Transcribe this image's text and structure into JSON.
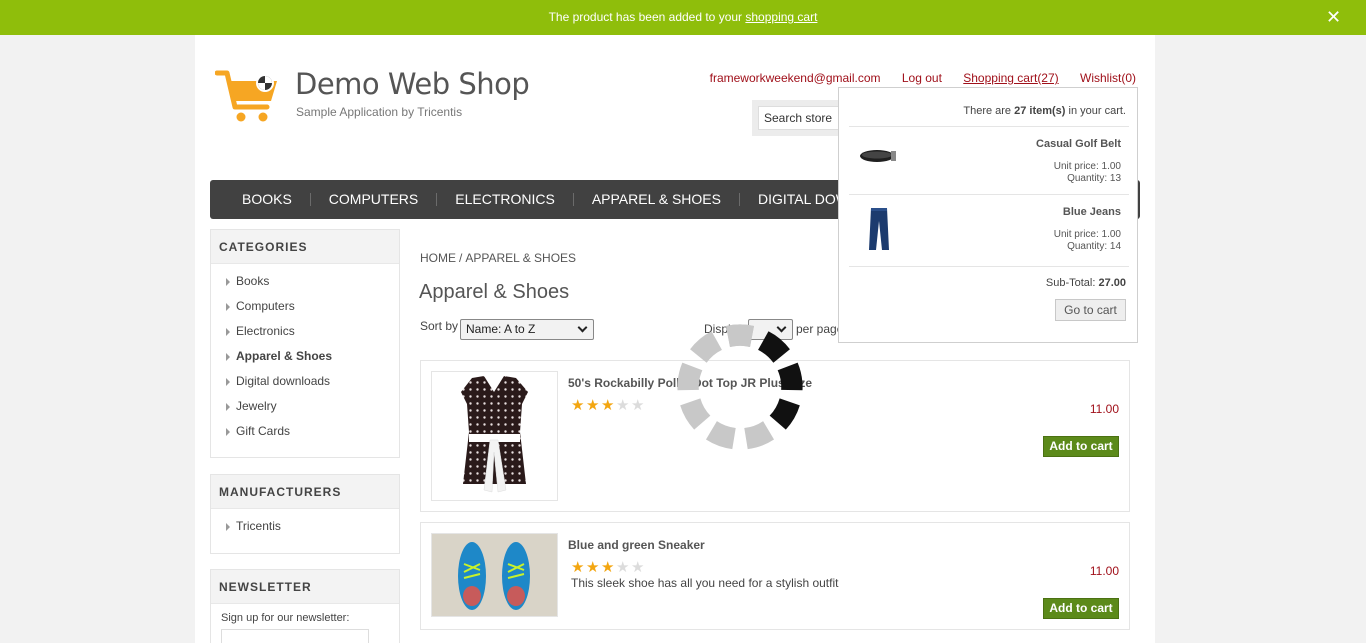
{
  "notification": {
    "text_prefix": "The product has been added to your ",
    "link": "shopping cart"
  },
  "header": {
    "logo_title": "Demo Web Shop",
    "logo_subtitle": "Sample Application by Tricentis",
    "links": {
      "email": "frameworkweekend@gmail.com",
      "logout": "Log out",
      "cart": "Shopping cart",
      "cart_count": "(27)",
      "wishlist": "Wishlist(0)"
    },
    "search_placeholder": "Search store"
  },
  "topmenu": [
    "BOOKS",
    "COMPUTERS",
    "ELECTRONICS",
    "APPAREL & SHOES",
    "DIGITAL DOWNLOADS"
  ],
  "categories": {
    "title": "CATEGORIES",
    "items": [
      "Books",
      "Computers",
      "Electronics",
      "Apparel & Shoes",
      "Digital downloads",
      "Jewelry",
      "Gift Cards"
    ]
  },
  "manufacturers": {
    "title": "MANUFACTURERS",
    "items": [
      "Tricentis"
    ]
  },
  "newsletter": {
    "title": "NEWSLETTER",
    "text": "Sign up for our newsletter:"
  },
  "breadcrumb": {
    "home": "HOME",
    "separator": "/",
    "current": "APPAREL & SHOES"
  },
  "page_title": "Apparel & Shoes",
  "sorting": {
    "label": "Sort by",
    "value": "Name: A to Z",
    "display_label": "Display",
    "per_page_label": "per page"
  },
  "products": [
    {
      "name": "50's Rockabilly Polka Dot Top JR Plus Size",
      "rating": 2.5,
      "description": "",
      "price": "11.00",
      "button": "Add to cart"
    },
    {
      "name": "Blue and green Sneaker",
      "rating": 2.5,
      "description": "This sleek shoe has all you need for a stylish outfit",
      "price": "11.00",
      "button": "Add to cart"
    }
  ],
  "flyout_cart": {
    "count_prefix": "There are ",
    "count": "27 item(s)",
    "count_suffix": " in your cart.",
    "items": [
      {
        "name": "Casual Golf Belt",
        "unit_price": "Unit price: 1.00",
        "quantity": "Quantity: 13"
      },
      {
        "name": "Blue Jeans",
        "unit_price": "Unit price: 1.00",
        "quantity": "Quantity: 14"
      }
    ],
    "subtotal_label": "Sub-Total: ",
    "subtotal_value": "27.00",
    "button": "Go to cart"
  },
  "colors": {
    "notification_bg": "#8fbe0b",
    "link_red": "#a0101a",
    "menu_bg": "#414141",
    "button_green": "#5c8a1a",
    "logo_orange": "#f6a623"
  }
}
